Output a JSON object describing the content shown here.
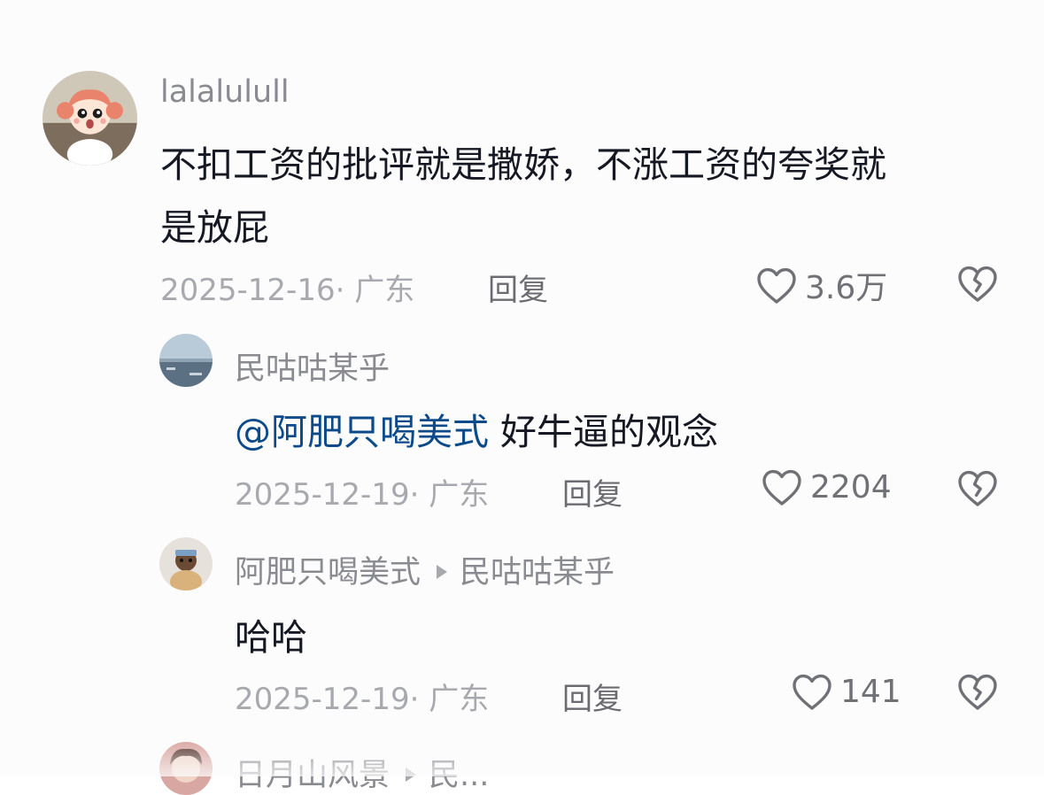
{
  "comments": [
    {
      "username": "lalalulull",
      "text_line1": "不扣工资的批评就是撒娇，不涨工资的夸奖就",
      "text_line2": "是放屁",
      "date_location": "2025-12-16· 广东",
      "reply_label": "回复",
      "likes": "3.6万"
    },
    {
      "username": "民咕咕某乎",
      "mention": "@阿肥只喝美式",
      "text": " 好牛逼的观念",
      "date_location": "2025-12-19· 广东",
      "reply_label": "回复",
      "likes": "2204"
    },
    {
      "username": "阿肥只喝美式",
      "reply_to": "民咕咕某乎",
      "text": "哈哈",
      "date_location": "2025-12-19· 广东",
      "reply_label": "回复",
      "likes": "141"
    },
    {
      "username": "日月山风景",
      "reply_to": "民..."
    }
  ],
  "colors": {
    "username": "#8a8b91",
    "text": "#161823",
    "mention": "#0c4a8a",
    "meta": "#a8a9ae"
  },
  "icons": [
    "heart-outline-icon",
    "broken-heart-icon",
    "triangle-right-icon"
  ]
}
